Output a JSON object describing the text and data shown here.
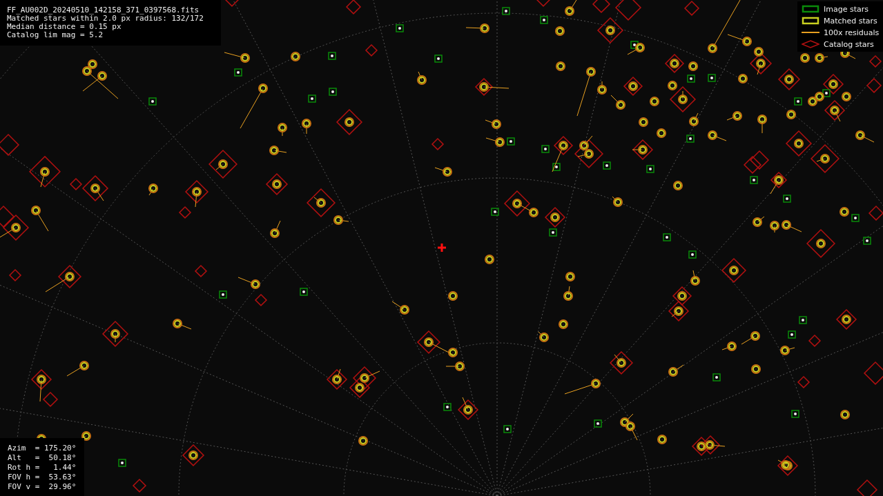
{
  "header": {
    "lines": [
      "FF_AU002D_20240510_142158_371_0397568.fits",
      "Matched stars within 2.0 px radius: 132/172",
      "Median distance = 0.15 px",
      "Catalog lim mag = 5.2"
    ]
  },
  "legend": [
    {
      "kind": "image",
      "label": "Image stars"
    },
    {
      "kind": "matched",
      "label": "Matched stars"
    },
    {
      "kind": "residual",
      "label": "100x residuals"
    },
    {
      "kind": "catalog",
      "label": "Catalog stars"
    }
  ],
  "pointing": {
    "lines": [
      "Azim  = 175.20°",
      "Alt   =  50.18°",
      "Rot h =   1.44°",
      "FOV h =  53.63°",
      "FOV v =  29.96°"
    ]
  }
}
